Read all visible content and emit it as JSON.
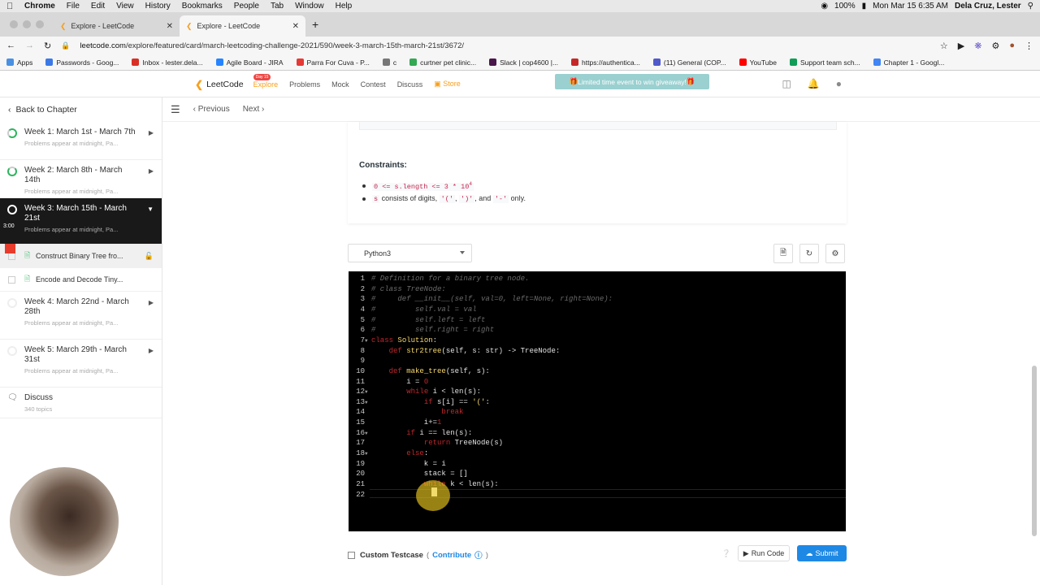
{
  "menubar": {
    "apple": "",
    "items": [
      "Chrome",
      "File",
      "Edit",
      "View",
      "History",
      "Bookmarks",
      "People",
      "Tab",
      "Window",
      "Help"
    ],
    "battery": "100%",
    "datetime": "Mon Mar 15  6:35 AM",
    "user": "Dela Cruz, Lester"
  },
  "tabs": [
    {
      "title": "Explore - LeetCode"
    },
    {
      "title": "Explore - LeetCode"
    }
  ],
  "address": {
    "url_domain": "leetcode.com",
    "url_path": "/explore/featured/card/march-leetcoding-challenge-2021/590/week-3-march-15th-march-21st/3672/"
  },
  "bookmarks": [
    {
      "label": "Apps",
      "color": "#4a90e2"
    },
    {
      "label": "Passwords - Goog...",
      "color": "#3b78e7"
    },
    {
      "label": "Inbox - lester.dela...",
      "color": "#d93025"
    },
    {
      "label": "Agile Board - JIRA",
      "color": "#2684ff"
    },
    {
      "label": "Parra For Cuva - P...",
      "color": "#e53935"
    },
    {
      "label": "c",
      "color": "#777777"
    },
    {
      "label": "curtner pet clinic...",
      "color": "#34a853"
    },
    {
      "label": "Slack | cop4600 |...",
      "color": "#4a154b"
    },
    {
      "label": "https://authentica...",
      "color": "#c62828"
    },
    {
      "label": "(11) General (COP...",
      "color": "#5059c9"
    },
    {
      "label": "YouTube",
      "color": "#ff0000"
    },
    {
      "label": "Support team sch...",
      "color": "#0f9d58"
    },
    {
      "label": "Chapter 1 - Googl...",
      "color": "#4285f4"
    }
  ],
  "lcnav": {
    "logo": "LeetCode",
    "links": [
      "Explore",
      "Problems",
      "Mock",
      "Contest",
      "Discuss",
      "Store"
    ],
    "explore_badge": "Day 15",
    "promo": "Limited time event to win giveaway!"
  },
  "sidebar": {
    "back": "Back to Chapter",
    "chapters": [
      {
        "title": "Week 1: March 1st - March 7th",
        "sub": "Problems appear at midnight, Pa..."
      },
      {
        "title": "Week 2: March 8th - March 14th",
        "sub": "Problems appear at midnight, Pa..."
      },
      {
        "title": "Week 3: March 15th - March 21st",
        "sub": "Problems appear at midnight, Pa..."
      },
      {
        "title": "Week 4: March 22nd - March 28th",
        "sub": "Problems appear at midnight, Pa..."
      },
      {
        "title": "Week 5: March 29th - March 31st",
        "sub": "Problems appear at midnight, Pa..."
      }
    ],
    "subitems": [
      "Construct Binary Tree fro...",
      "Encode and Decode Tiny..."
    ],
    "discuss": {
      "title": "Discuss",
      "sub": "340 topics"
    },
    "timer": "3:00"
  },
  "toolbar": {
    "previous": "Previous",
    "next": "Next"
  },
  "problem": {
    "constraints_title": "Constraints:",
    "c1_code": "0 <= s.length <= 3 * 10",
    "c1_sup": "4",
    "c2_code_s": "s",
    "c2_text": " consists of digits, ",
    "c2_code_a": "'('",
    "c2_sep1": ", ",
    "c2_code_b": "')'",
    "c2_sep2": ", and ",
    "c2_code_c": "'-'",
    "c2_end": " only."
  },
  "editor": {
    "language": "Python3",
    "lines": [
      "# Definition for a binary tree node.",
      "# class TreeNode:",
      "#     def __init__(self, val=0, left=None, right=None):",
      "#         self.val = val",
      "#         self.left = left",
      "#         self.right = right",
      "class Solution:",
      "    def str2tree(self, s: str) -> TreeNode:",
      "",
      "    def make_tree(self, s):",
      "        i = 0",
      "        while i < len(s):",
      "            if s[i] == '(':",
      "                break",
      "            i+=1",
      "        if i == len(s):",
      "            return TreeNode(s)",
      "        else:",
      "            k = i",
      "            stack = []",
      "            while k < len(s):",
      ""
    ]
  },
  "bottom": {
    "custom_testcase": "Custom Testcase",
    "open_paren": "(",
    "contribute": "Contribute",
    "close_paren": ")",
    "run": "Run Code",
    "submit": "Submit"
  }
}
